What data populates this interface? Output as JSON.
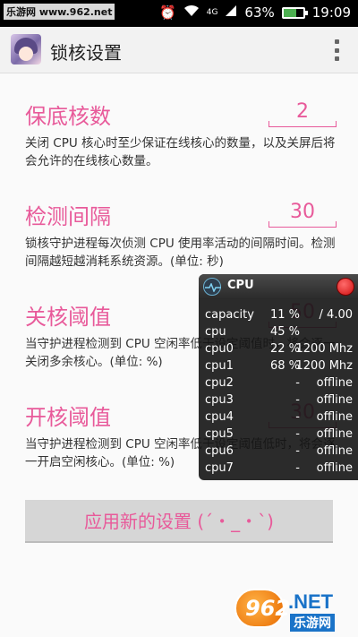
{
  "status_bar": {
    "site_label": "乐游网 www.962.net",
    "network": "4G",
    "battery": "63%",
    "battery_level": 0.63,
    "time": "19:09"
  },
  "app": {
    "title": "锁核设置"
  },
  "settings": [
    {
      "title": "保底核数",
      "value": "2",
      "desc": "关闭 CPU 核心时至少保证在线核心的数量，以及关屏后将会允许的在线核心数量。"
    },
    {
      "title": "检测间隔",
      "value": "30",
      "desc": "锁核守护进程每次侦测 CPU 使用率活动的间隔时间。检测间隔越短越消耗系统资源。(单位: 秒)"
    },
    {
      "title": "关核阈值",
      "value": "50",
      "desc": "当守护进程检测到 CPU 空闲率低于设定阈值时，将会逐一关闭多余核心。(单位: %)"
    },
    {
      "title": "开核阈值",
      "value": "30",
      "desc": "当守护进程检测到 CPU 空闲率低于设定阈值低时，将会逐一开启空闲核心。(单位: %)"
    }
  ],
  "apply_button": "应用新的设置 (´・_・`)",
  "cpu_overlay": {
    "title": "CPU",
    "rows": [
      {
        "name": "capacity",
        "pct": "11 %",
        "val": "/ 4.00"
      },
      {
        "name": "cpu",
        "pct": "45 %",
        "val": ""
      },
      {
        "name": "cpu0",
        "pct": "22 %",
        "val": "1200 Mhz"
      },
      {
        "name": "cpu1",
        "pct": "68 %",
        "val": "1200 Mhz"
      },
      {
        "name": "cpu2",
        "pct": "-",
        "val": "offline"
      },
      {
        "name": "cpu3",
        "pct": "-",
        "val": "offline"
      },
      {
        "name": "cpu4",
        "pct": "-",
        "val": "offline"
      },
      {
        "name": "cpu5",
        "pct": "-",
        "val": "offline"
      },
      {
        "name": "cpu6",
        "pct": "-",
        "val": "offline"
      },
      {
        "name": "cpu7",
        "pct": "-",
        "val": "offline"
      }
    ]
  },
  "watermark": {
    "number": "962",
    "net": ".NET",
    "cn": "乐游网"
  },
  "colors": {
    "accent": "#e85a9a",
    "appbar": "#f2f2f2"
  }
}
